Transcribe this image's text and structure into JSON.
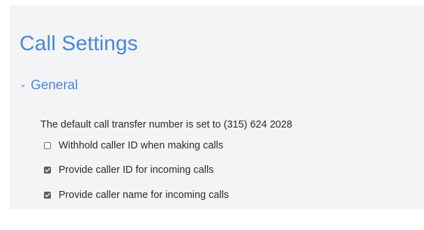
{
  "page": {
    "title": "Call Settings"
  },
  "section": {
    "title": "General",
    "expanded": true,
    "chevron_icon": "triangle-down-icon",
    "transfer_text": "The default call transfer number is set to (315) 624 2028"
  },
  "options": [
    {
      "label": "Withhold caller ID when making calls",
      "checked": false
    },
    {
      "label": "Provide caller ID for incoming calls",
      "checked": true
    },
    {
      "label": "Provide caller name for incoming calls",
      "checked": true
    }
  ],
  "colors": {
    "accent": "#4a86d2",
    "panel_background": "#f3f4f6",
    "text": "#2b2b2b",
    "checkbox_checked": "#5f5f5f"
  }
}
